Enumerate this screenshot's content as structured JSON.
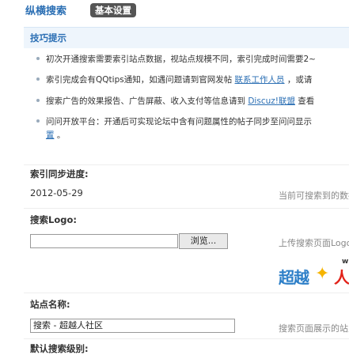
{
  "header": {
    "brand": "纵横搜索",
    "tab_label": "基本设置"
  },
  "tips": {
    "title": "技巧提示",
    "items": [
      {
        "text": "初次开通搜索需要索引站点数据，视站点规模不同，索引完成时间需要2~"
      },
      {
        "text_before": "索引完成会有QQtips通知，如遇问题请到官网发帖 ",
        "link": "联系工作人员",
        "text_after": " ，或请"
      },
      {
        "text_before": "搜索广告的效果报告、广告屏蔽、收入支付等信息请到 ",
        "link": "Discuz!联盟",
        "text_after": " 查看"
      },
      {
        "line1": "问问开放平台：开通后可实现论坛中含有问题属性的帖子同步至问问显示",
        "link": "置",
        "text_after": " 。"
      }
    ]
  },
  "index_progress": {
    "label": "索引同步进度:",
    "value": "2012-05-29",
    "hint": "当前可搜索到的数据"
  },
  "search_logo": {
    "label": "搜索Logo:",
    "browse_label": "浏览...",
    "hint": "上传搜索页面Logo",
    "logo_prefix": "超越",
    "logo_suffix": "人",
    "logo_corner": "w"
  },
  "site_name": {
    "label": "站点名称:",
    "value": "搜索 - 超越人社区",
    "hint": "搜索页面展示的站点名"
  },
  "default_search": {
    "label": "默认搜索级别:"
  }
}
